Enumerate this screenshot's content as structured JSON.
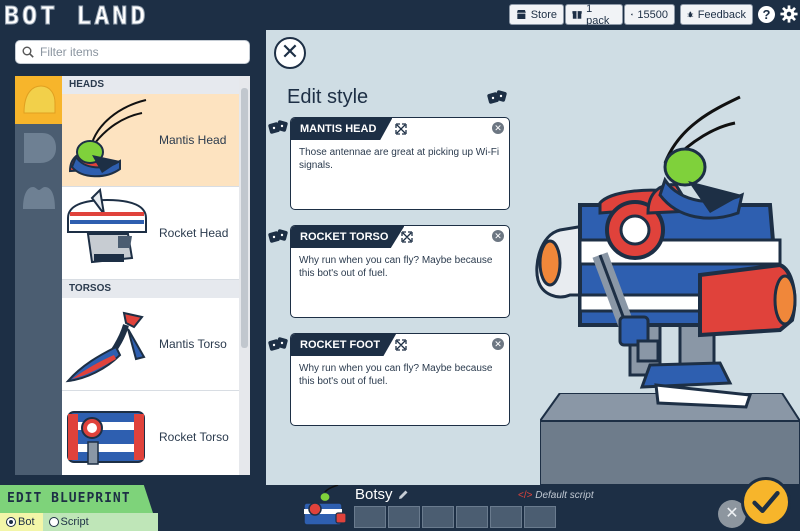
{
  "app": {
    "title": "BOT LAND"
  },
  "topbar": {
    "store_label": "Store",
    "pack_label": "1 pack",
    "coins_label": "15500",
    "feedback_label": "Feedback",
    "help_label": "?"
  },
  "sidebar": {
    "filter_placeholder": "Filter items",
    "categories": [
      "heads-category",
      "torsos-category",
      "feet-category"
    ],
    "sections": [
      {
        "title": "HEADS",
        "items": [
          {
            "label": "Mantis Head"
          },
          {
            "label": "Rocket Head"
          }
        ]
      },
      {
        "title": "TORSOS",
        "items": [
          {
            "label": "Mantis Torso"
          },
          {
            "label": "Rocket Torso"
          }
        ]
      }
    ]
  },
  "editor": {
    "title": "Edit style",
    "cards": [
      {
        "title": "MANTIS HEAD",
        "desc": "Those antennae are great at picking up Wi-Fi signals."
      },
      {
        "title": "ROCKET TORSO",
        "desc": "Why run when you can fly? Maybe because this bot's out of fuel."
      },
      {
        "title": "ROCKET FOOT",
        "desc": "Why run when you can fly? Maybe because this bot's out of fuel."
      }
    ]
  },
  "bottom": {
    "edit_blueprint": "EDIT BLUEPRINT",
    "mode_bot": "Bot",
    "mode_script": "Script",
    "active_mode": "Bot",
    "bot_name": "Botsy",
    "script_label": "Default script",
    "slot_count": 6
  },
  "colors": {
    "navy": "#1d2f45",
    "accent_orange": "#f7b52b",
    "green": "#7ed37a",
    "selected_row": "#fde3c0",
    "rocket_red": "#e0423b",
    "rocket_blue": "#2e5fb0",
    "mantis_green": "#7fd13b"
  }
}
